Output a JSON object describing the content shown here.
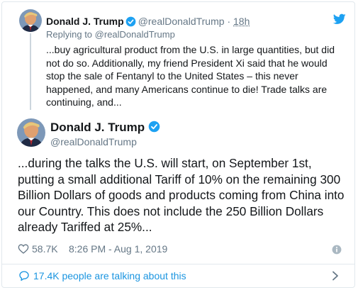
{
  "reply_tweet": {
    "author_name": "Donald J. Trump",
    "handle": "@realDonaldTrump",
    "separator": "·",
    "time": "18h",
    "replying_prefix": "Replying to",
    "replying_to": "@realDonaldTrump",
    "text": "...buy agricultural product from the U.S. in large quantities, but did not do so. Additionally, my friend President Xi said that he would stop the sale of Fentanyl to the United States – this never happened, and many Americans continue to die! Trade talks are continuing, and..."
  },
  "main_tweet": {
    "author_name": "Donald J. Trump",
    "handle": "@realDonaldTrump",
    "text": "...during the talks the U.S. will start, on September 1st, putting a small additional Tariff of 10% on the remaining 300 Billion Dollars of goods and products coming from China into our Country. This does not include the 250 Billion Dollars already Tariffed at 25%...",
    "likes": "58.7K",
    "timestamp": "8:26 PM - Aug 1, 2019"
  },
  "footer": {
    "talking": "17.4K people are talking about this"
  },
  "icons": {
    "brand": "twitter-bird-icon",
    "verified": "verified-badge-icon",
    "like": "heart-icon",
    "info": "info-icon",
    "comment": "speech-bubble-icon",
    "next": "chevron-right-icon"
  },
  "colors": {
    "accent": "#1da1f2",
    "link": "#1b95e0",
    "secondary_text": "#657786",
    "primary_text": "#14171a",
    "border": "#e1e8ed"
  }
}
